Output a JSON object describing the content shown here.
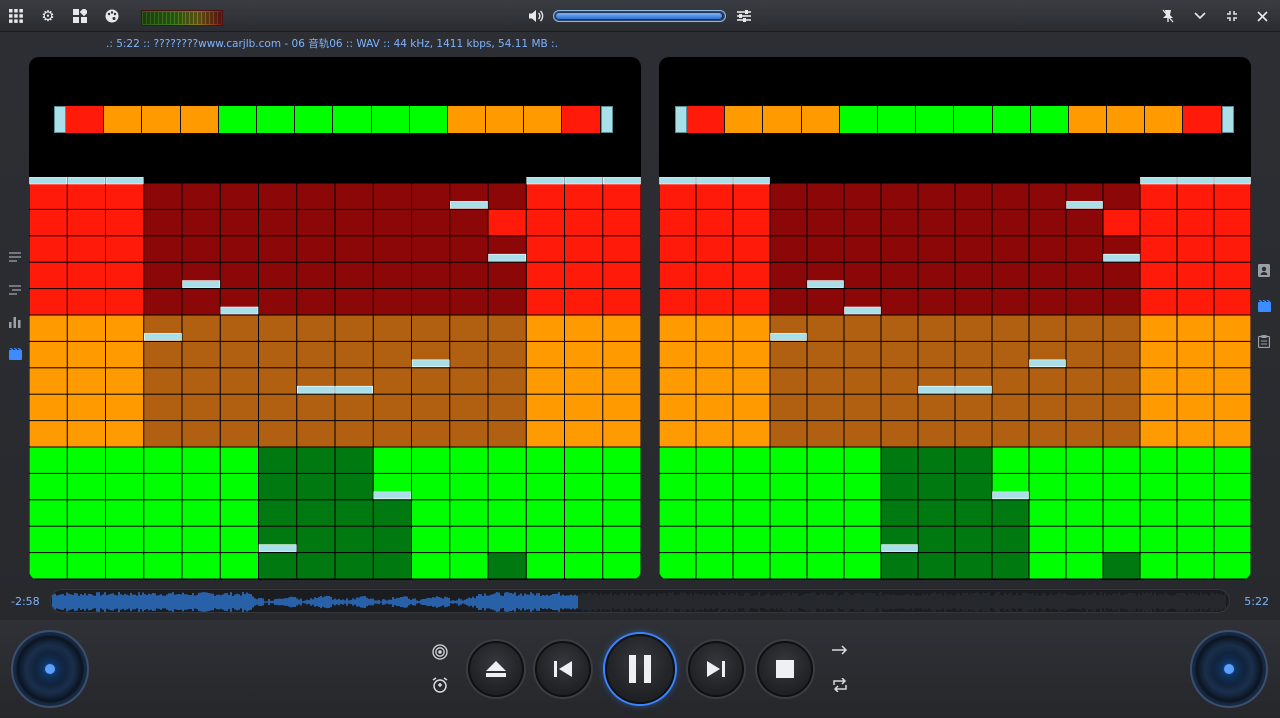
{
  "topbar": {
    "icons": [
      "apps-grid-icon",
      "gear-icon",
      "dashboard-icon",
      "palette-icon",
      "volume-icon",
      "equalizer-icon",
      "pin-icon",
      "chevron-down-icon",
      "minimize-icon",
      "close-icon"
    ],
    "volume_percent": 98
  },
  "track_info": ".: 5:22 :: ????????www.carjlb.com - 06 音轨06 :: WAV :: 44 kHz, 1411 kbps, 54.11 MB :.",
  "spectrum": {
    "columns": 16,
    "rows": 15,
    "levels_left": [
      15,
      15,
      15,
      11,
      11,
      10,
      8,
      8,
      8,
      8,
      8,
      14,
      14,
      15,
      15,
      15
    ],
    "levels_right": [
      15,
      15,
      15,
      11,
      11,
      10,
      8,
      8,
      8,
      8,
      8,
      14,
      14,
      15,
      15,
      15
    ],
    "dim_top_left": [
      0,
      0,
      0,
      10,
      10,
      10,
      13,
      13,
      13,
      13,
      10,
      10,
      8,
      0,
      0,
      0
    ],
    "dim_top_right": [
      0,
      0,
      0,
      10,
      10,
      10,
      13,
      13,
      13,
      13,
      10,
      10,
      8,
      0,
      0,
      0
    ],
    "dim_green_left": [
      0,
      0,
      0,
      0,
      0,
      0,
      5,
      5,
      5,
      3,
      0,
      0,
      1,
      0,
      0,
      0
    ],
    "dim_green_right": [
      0,
      0,
      0,
      0,
      0,
      0,
      5,
      5,
      5,
      3,
      0,
      0,
      1,
      0,
      0,
      0
    ],
    "peaks_left": [
      15,
      15,
      15,
      9,
      11,
      10,
      1,
      7,
      7,
      3,
      8,
      14,
      12,
      15,
      15,
      15
    ],
    "peaks_right": [
      15,
      15,
      15,
      9,
      11,
      10,
      1,
      7,
      7,
      3,
      8,
      14,
      12,
      15,
      15,
      15
    ],
    "peakbar_left": [
      "red",
      "orange",
      "orange",
      "orange",
      "green",
      "green",
      "green",
      "green",
      "green",
      "green",
      "orange",
      "orange",
      "orange",
      "red"
    ],
    "peakbar_right": [
      "red",
      "orange",
      "orange",
      "orange",
      "green",
      "green",
      "green",
      "green",
      "green",
      "green",
      "orange",
      "orange",
      "orange",
      "red"
    ],
    "colors": {
      "green": "#00ff00",
      "green_dim": "#007a10",
      "orange": "#ff9a00",
      "orange_dim": "#b06010",
      "red": "#ff1a0a",
      "red_dim": "#8c0808",
      "peak": "#a9dfe8"
    }
  },
  "seek": {
    "elapsed": "-2:58",
    "total": "5:22",
    "progress": 0.447
  },
  "controls": {
    "eject": "eject-icon",
    "prev": "previous-icon",
    "play_pause": "pause-icon",
    "next": "next-icon",
    "stop": "stop-icon",
    "left_icons": [
      "broadcast-icon",
      "alarm-icon"
    ],
    "right_icons": [
      "arrow-right-icon",
      "repeat-icon"
    ]
  },
  "sidebar_left": [
    "playlist-icon",
    "queue-icon",
    "bar-chart-icon",
    "video-icon"
  ],
  "sidebar_right": [
    "contact-icon",
    "video-icon",
    "clipboard-icon"
  ]
}
